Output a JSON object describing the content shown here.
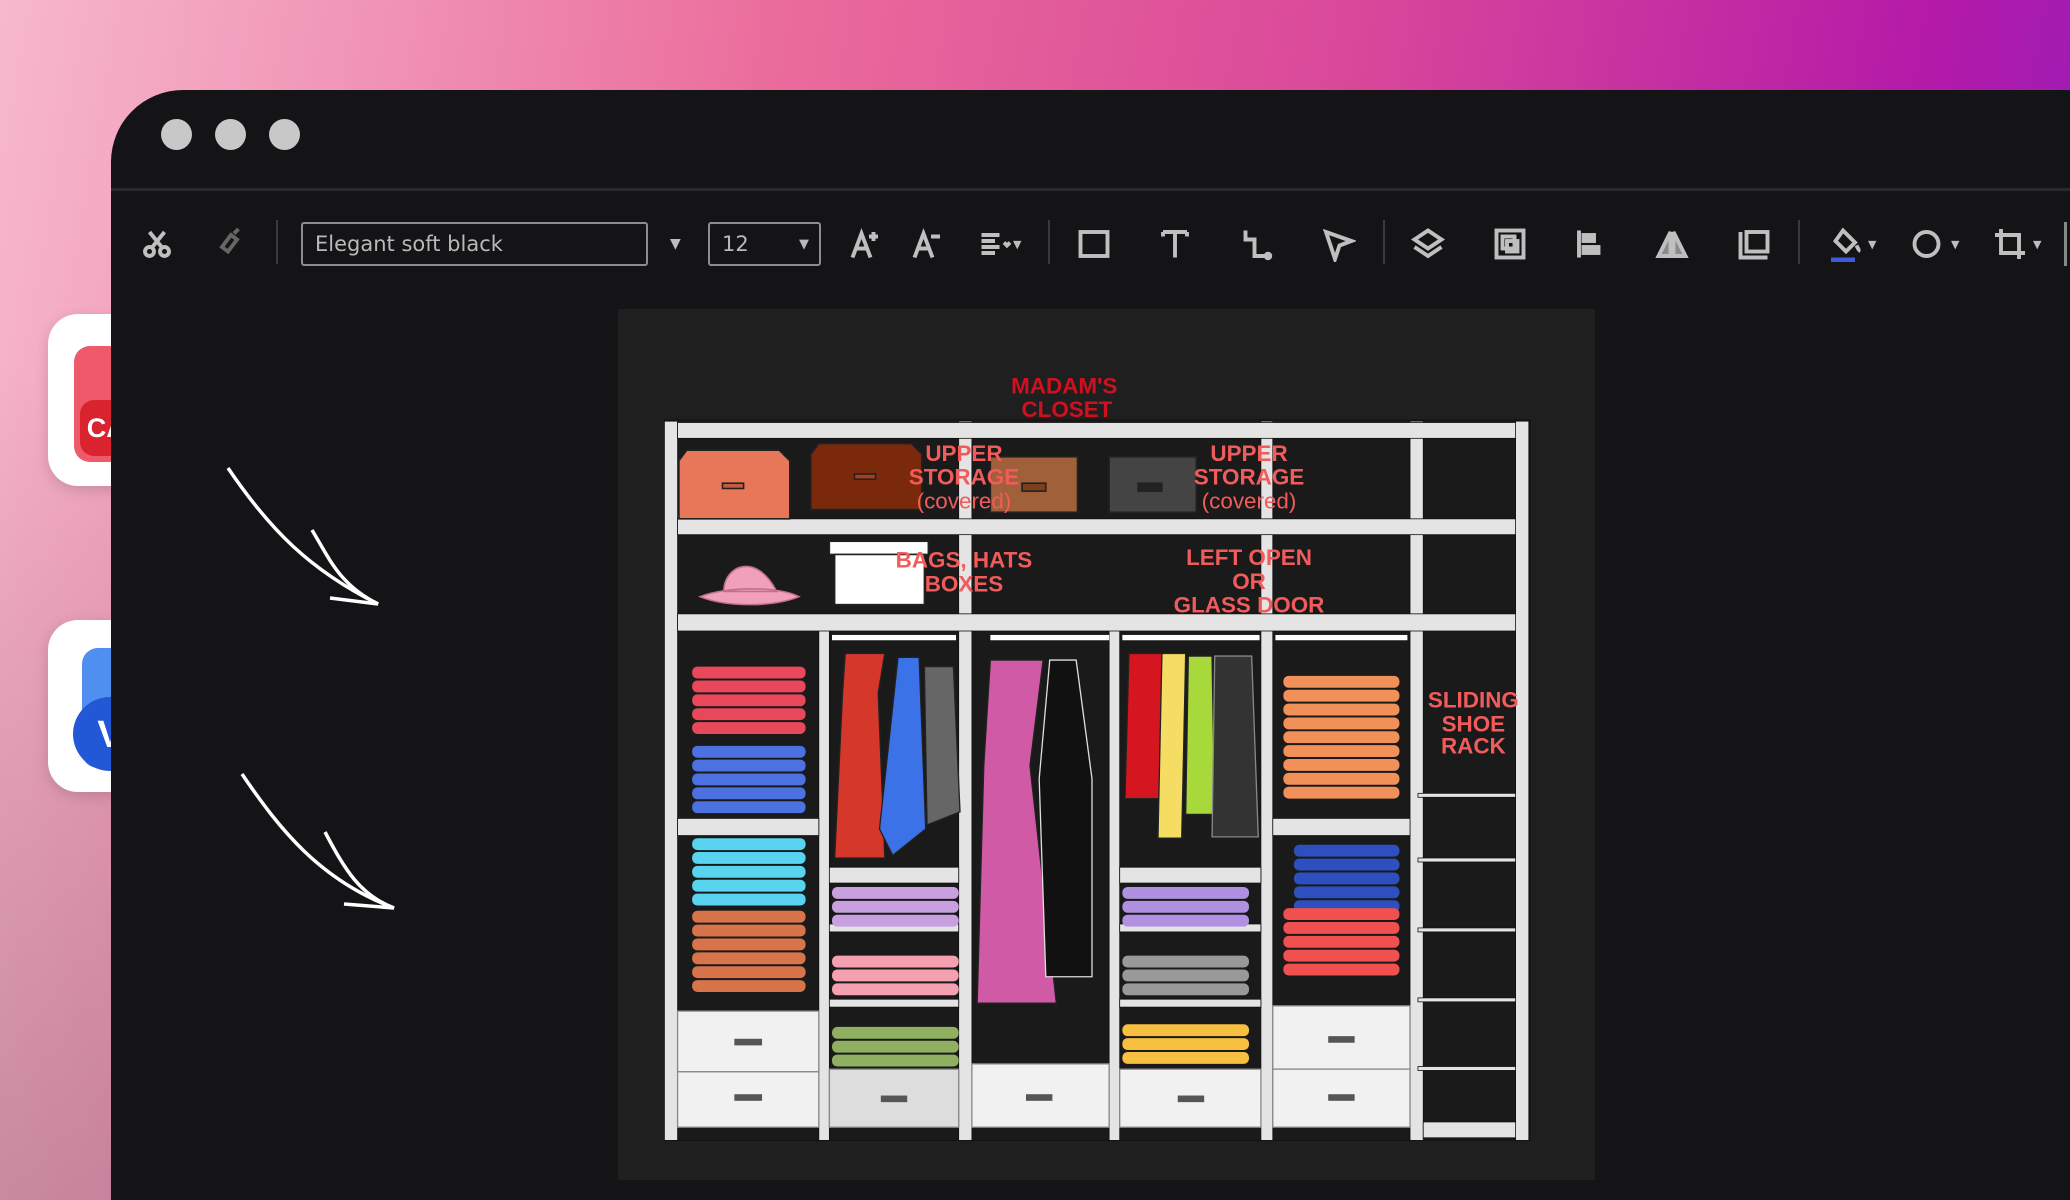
{
  "toolbar": {
    "font_value": "Elegant soft black",
    "size_value": "12",
    "icons": [
      "scissors-icon",
      "format-painter-icon",
      "increase-font-icon",
      "decrease-font-icon",
      "align-icon",
      "rectangle-icon",
      "text-icon",
      "connector-icon",
      "pointer-icon",
      "layers-icon",
      "group-icon",
      "align-left-icon",
      "flip-icon",
      "container-icon",
      "fill-color-icon",
      "shape-icon",
      "crop-icon"
    ],
    "fill_accent": "#3b5bdb"
  },
  "apps": {
    "cad_label": "CAD",
    "visio_label": "V"
  },
  "diagram": {
    "title": [
      "MADAM'S",
      "CLOSET"
    ],
    "upper_storage_left": [
      "UPPER",
      "STORAGE",
      "(covered)"
    ],
    "upper_storage_right": [
      "UPPER",
      "STORAGE",
      "(covered)"
    ],
    "bags_hats": [
      "BAGS, HATS",
      "BOXES"
    ],
    "left_open": [
      "LEFT OPEN",
      "OR",
      "GLASS DOOR"
    ],
    "shoe_rack": [
      "SLIDING",
      "SHOE",
      "RACK"
    ],
    "title_color": "#d0101e",
    "label_color": "#f25b5b"
  }
}
